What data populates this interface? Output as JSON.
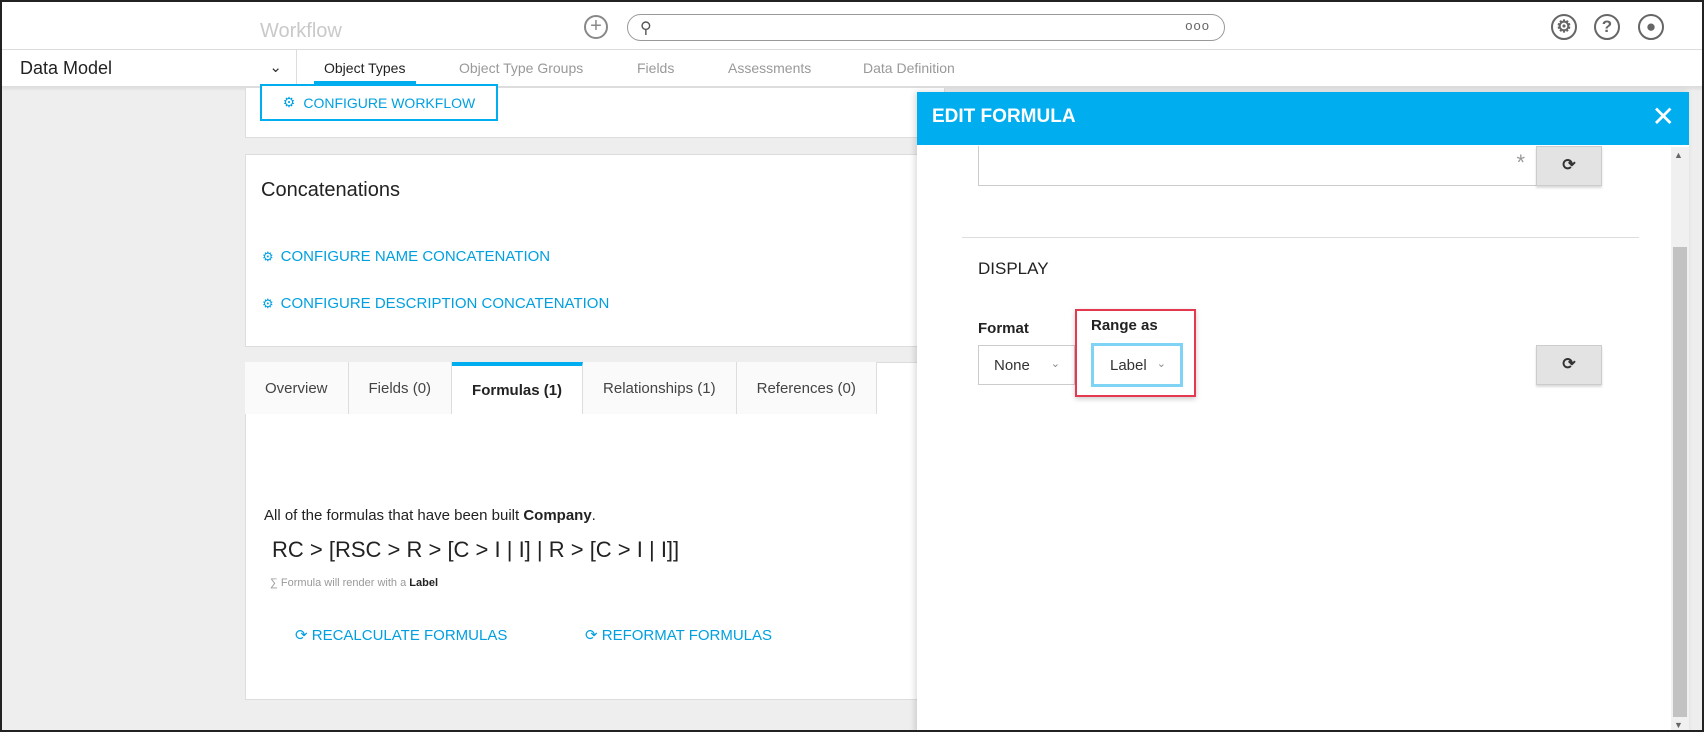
{
  "header": {
    "ghost_title": "Workflow",
    "add_icon": "plus-circle-icon",
    "search_placeholder": "",
    "search_more": "ooo",
    "icons": [
      "gear-icon",
      "help-icon",
      "user-icon"
    ]
  },
  "nav": {
    "module_select": "Data Model",
    "tabs": [
      {
        "label": "Object Types",
        "active": true
      },
      {
        "label": "Object Type Groups",
        "active": false
      },
      {
        "label": "Fields",
        "active": false
      },
      {
        "label": "Assessments",
        "active": false
      },
      {
        "label": "Data Definition",
        "active": false
      }
    ]
  },
  "workflow_card": {
    "configure_button": "CONFIGURE WORKFLOW"
  },
  "concatenations": {
    "title": "Concatenations",
    "links": [
      "CONFIGURE NAME CONCATENATION",
      "CONFIGURE DESCRIPTION CONCATENATION"
    ]
  },
  "detail_tabs": [
    {
      "label": "Overview",
      "active": false
    },
    {
      "label": "Fields (0)",
      "active": false
    },
    {
      "label": "Formulas (1)",
      "active": true
    },
    {
      "label": "Relationships (1)",
      "active": false
    },
    {
      "label": "References (0)",
      "active": false
    }
  ],
  "formulas": {
    "description_prefix": "All of the formulas that have been built",
    "description_entity": "Company",
    "description_suffix": ".",
    "formula_text": "RC > [RSC > R > [C > I | I] | R > [C > I | I]]",
    "hint_prefix": "Formula will render with a",
    "hint_value": "Label",
    "recalculate": "RECALCULATE FORMULAS",
    "reformat": "REFORMAT FORMULAS"
  },
  "edit_panel": {
    "title": "EDIT FORMULA",
    "required_marker": "*",
    "display_title": "DISPLAY",
    "format_label": "Format",
    "format_value": "None",
    "range_label": "Range as",
    "range_value": "Label"
  },
  "colors": {
    "accent": "#00aeef",
    "link": "#00a0e0",
    "highlight": "#e53950"
  }
}
